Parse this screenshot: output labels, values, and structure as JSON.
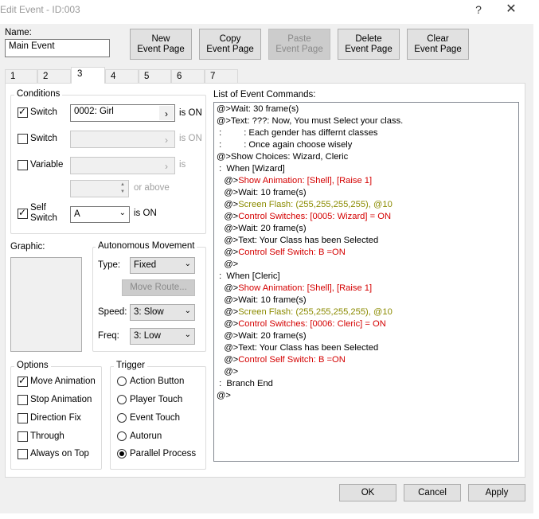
{
  "window": {
    "title": "Edit Event - ID:003",
    "help": "?",
    "close": "✕"
  },
  "name": {
    "label": "Name:",
    "value": "Main Event"
  },
  "top_buttons": [
    {
      "l1": "New",
      "l2": "Event Page"
    },
    {
      "l1": "Copy",
      "l2": "Event Page"
    },
    {
      "l1": "Paste",
      "l2": "Event Page"
    },
    {
      "l1": "Delete",
      "l2": "Event Page"
    },
    {
      "l1": "Clear",
      "l2": "Event Page"
    }
  ],
  "tabs": [
    "1",
    "2",
    "3",
    "4",
    "5",
    "6",
    "7"
  ],
  "conditions": {
    "title": "Conditions",
    "switch1": {
      "label": "Switch",
      "value": "0002: Girl",
      "suffix": "is ON"
    },
    "switch2": {
      "label": "Switch",
      "value": "",
      "suffix": "is ON"
    },
    "variable": {
      "label": "Variable",
      "value": "",
      "suffix": "is",
      "amount": "",
      "or_above": "or above"
    },
    "self_switch": {
      "label1": "Self",
      "label2": "Switch",
      "value": "A",
      "suffix": "is ON"
    }
  },
  "graphic": {
    "label": "Graphic:"
  },
  "autonomous": {
    "title": "Autonomous Movement",
    "type_label": "Type:",
    "type_value": "Fixed",
    "move_route": "Move Route...",
    "speed_label": "Speed:",
    "speed_value": "3: Slow",
    "freq_label": "Freq:",
    "freq_value": "3: Low"
  },
  "options": {
    "title": "Options",
    "items": [
      "Move Animation",
      "Stop Animation",
      "Direction Fix",
      "Through",
      "Always on Top"
    ]
  },
  "trigger": {
    "title": "Trigger",
    "items": [
      "Action Button",
      "Player Touch",
      "Event Touch",
      "Autorun",
      "Parallel Process"
    ]
  },
  "commands": {
    "title": "List of Event Commands:",
    "lines": [
      {
        "indent": "",
        "prefix": "@>",
        "text": "Wait: 30 frame(s)",
        "color": "black"
      },
      {
        "indent": "",
        "prefix": "@>",
        "text": "Text: ???: Now, You must Select your class.",
        "color": "black"
      },
      {
        "indent": " :",
        "prefix": "",
        "text": "         : Each gender has differnt classes",
        "color": "black"
      },
      {
        "indent": " :",
        "prefix": "",
        "text": "         : Once again choose wisely",
        "color": "black"
      },
      {
        "indent": "",
        "prefix": "@>",
        "text": "Show Choices: Wizard, Cleric",
        "color": "black"
      },
      {
        "indent": " : ",
        "prefix": "",
        "text": " When [Wizard]",
        "color": "black"
      },
      {
        "indent": "   ",
        "prefix": "@>",
        "text": "Show Animation: [Shell], [Raise 1]",
        "color": "red"
      },
      {
        "indent": "   ",
        "prefix": "@>",
        "text": "Wait: 10 frame(s)",
        "color": "black"
      },
      {
        "indent": "   ",
        "prefix": "@>",
        "text": "Screen Flash: (255,255,255,255), @10",
        "color": "olive"
      },
      {
        "indent": "   ",
        "prefix": "@>",
        "text": "Control Switches: [0005: Wizard] = ON",
        "color": "red"
      },
      {
        "indent": "   ",
        "prefix": "@>",
        "text": "Wait: 20 frame(s)",
        "color": "black"
      },
      {
        "indent": "   ",
        "prefix": "@>",
        "text": "Text: Your Class has been Selected",
        "color": "black"
      },
      {
        "indent": "   ",
        "prefix": "@>",
        "text": "Control Self Switch: B =ON",
        "color": "red"
      },
      {
        "indent": "   ",
        "prefix": "@>",
        "text": "",
        "color": "black"
      },
      {
        "indent": " : ",
        "prefix": "",
        "text": " When [Cleric]",
        "color": "black"
      },
      {
        "indent": "   ",
        "prefix": "@>",
        "text": "Show Animation: [Shell], [Raise 1]",
        "color": "red"
      },
      {
        "indent": "   ",
        "prefix": "@>",
        "text": "Wait: 10 frame(s)",
        "color": "black"
      },
      {
        "indent": "   ",
        "prefix": "@>",
        "text": "Screen Flash: (255,255,255,255), @10",
        "color": "olive"
      },
      {
        "indent": "   ",
        "prefix": "@>",
        "text": "Control Switches: [0006: Cleric] = ON",
        "color": "red"
      },
      {
        "indent": "   ",
        "prefix": "@>",
        "text": "Wait: 20 frame(s)",
        "color": "black"
      },
      {
        "indent": "   ",
        "prefix": "@>",
        "text": "Text: Your Class has been Selected",
        "color": "black"
      },
      {
        "indent": "   ",
        "prefix": "@>",
        "text": "Control Self Switch: B =ON",
        "color": "red"
      },
      {
        "indent": "   ",
        "prefix": "@>",
        "text": "",
        "color": "black"
      },
      {
        "indent": " : ",
        "prefix": "",
        "text": " Branch End",
        "color": "black"
      },
      {
        "indent": "",
        "prefix": "@>",
        "text": "",
        "color": "black"
      }
    ]
  },
  "bottom_buttons": {
    "ok": "OK",
    "cancel": "Cancel",
    "apply": "Apply"
  },
  "icons": {
    "right_arrow": "›",
    "down_arrow": "⌄",
    "spin_up": "▲",
    "spin_down": "▼"
  },
  "colors": {
    "red": "#d40000",
    "olive": "#8b8b00"
  }
}
